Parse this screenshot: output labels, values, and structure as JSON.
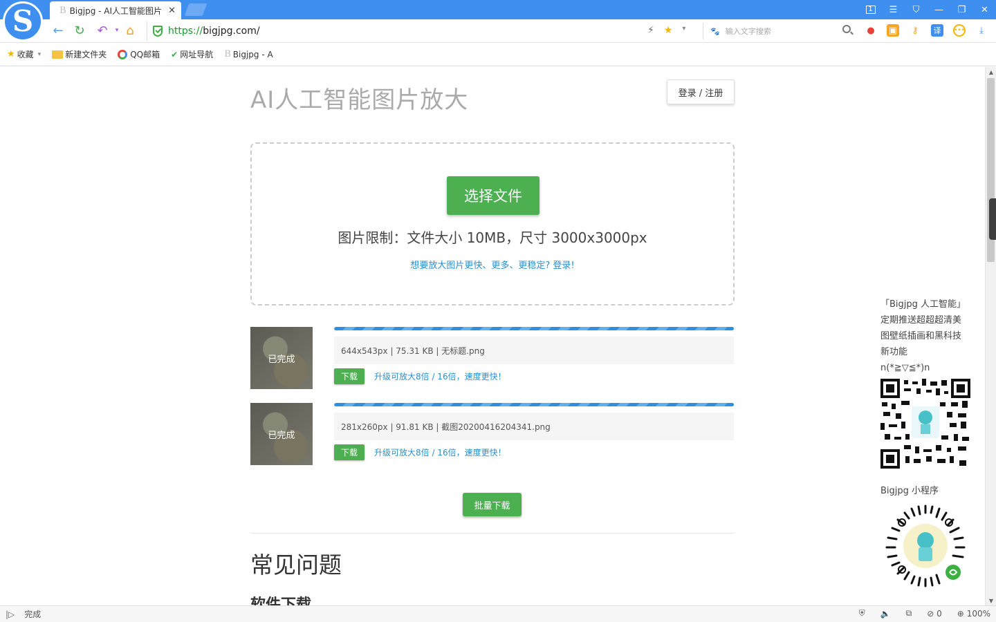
{
  "browser": {
    "tab_title": "Bigjpg - AI人工智能图片",
    "tab_favicon": "B",
    "url_scheme": "https://",
    "url_host": "bigjpg.com/",
    "search_placeholder": "输入文字搜索",
    "window_badge": "1",
    "accent_color": "#3f8ff0"
  },
  "bookmarks": [
    {
      "label": "收藏",
      "icon": "star-icon"
    },
    {
      "label": "新建文件夹",
      "icon": "folder-icon"
    },
    {
      "label": "QQ邮箱",
      "icon": "qq-mail-icon"
    },
    {
      "label": "网址导航",
      "icon": "hao-nav-icon"
    },
    {
      "label": "Bigjpg - A",
      "icon": "bigjpg-icon"
    }
  ],
  "page": {
    "title": "AI人工智能图片放大",
    "login_label": "登录 / 注册",
    "choose_file_label": "选择文件",
    "limit_text": "图片限制：文件大小 10MB，尺寸 3000x3000px",
    "upsell_link": "想要放大图片更快、更多、更稳定? 登录!",
    "files": [
      {
        "status": "已完成",
        "info": "644x543px | 75.31 KB | 无标题.png",
        "download_label": "下载",
        "upgrade_link": "升级可放大8倍 / 16倍，速度更快！",
        "progress": 1.0
      },
      {
        "status": "已完成",
        "info": "281x260px | 91.81 KB | 截图20200416204341.png",
        "download_label": "下载",
        "upgrade_link": "升级可放大8倍 / 16倍，速度更快！",
        "progress": 1.0
      }
    ],
    "batch_download_label": "批量下载",
    "faq_title": "常见问题",
    "faq_sub": "软件下载",
    "brand_color": "#4caf50",
    "link_color": "#2a8fd0"
  },
  "side_panel": {
    "lines": [
      "「Bigjpg 人工智能」",
      "定期推送超超超清美",
      "图壁纸插画和黑科技",
      "新功能",
      "n(*≧▽≦*)n"
    ],
    "miniprogram_label": "Bigjpg 小程序"
  },
  "status": {
    "text": "完成",
    "counter": "0",
    "zoom": "100%"
  }
}
